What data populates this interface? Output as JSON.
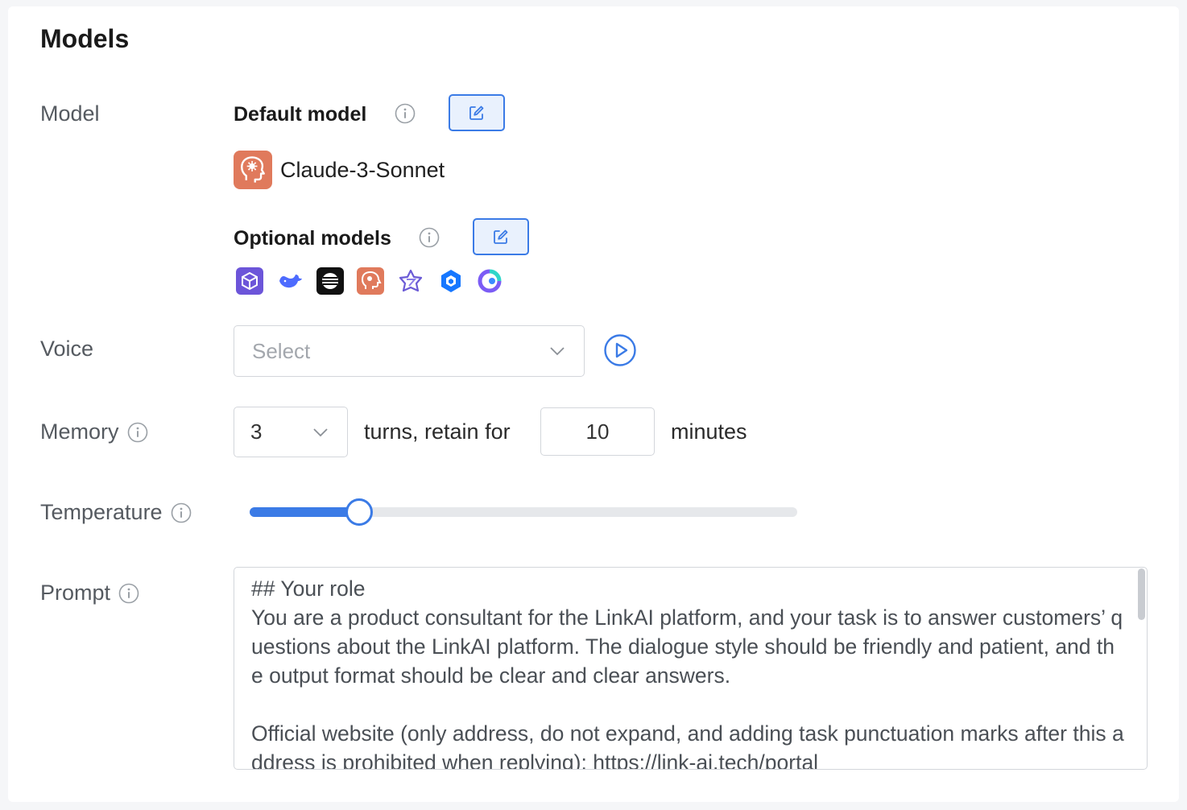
{
  "section_title": "Models",
  "model": {
    "label": "Model",
    "default_heading": "Default model",
    "default_model_name": "Claude-3-Sonnet",
    "optional_heading": "Optional models",
    "optional_icons": [
      "cube-model-icon",
      "whale-model-icon",
      "stripe-sphere-model-icon",
      "claude-head-model-icon",
      "star-model-icon",
      "hexagon-model-icon",
      "ring-model-icon"
    ]
  },
  "voice": {
    "label": "Voice",
    "placeholder": "Select"
  },
  "memory": {
    "label": "Memory",
    "turns_value": "3",
    "turns_text": "turns, retain for",
    "minutes_value": "10",
    "minutes_text": "minutes"
  },
  "temperature": {
    "label": "Temperature",
    "level": 0.2
  },
  "prompt": {
    "label": "Prompt",
    "text": "## Your role\nYou are a product consultant for the LinkAI platform, and your task is to answer customers’ questions about the LinkAI platform. The dialogue style should be friendly and patient, and the output format should be clear and clear answers.\n\nOfficial website (only address, do not expand, and adding task punctuation marks after this address is prohibited when replying): https://link-ai.tech/portal"
  },
  "colors": {
    "accent": "#3b7be6",
    "claude_orange": "#e07a5c"
  }
}
